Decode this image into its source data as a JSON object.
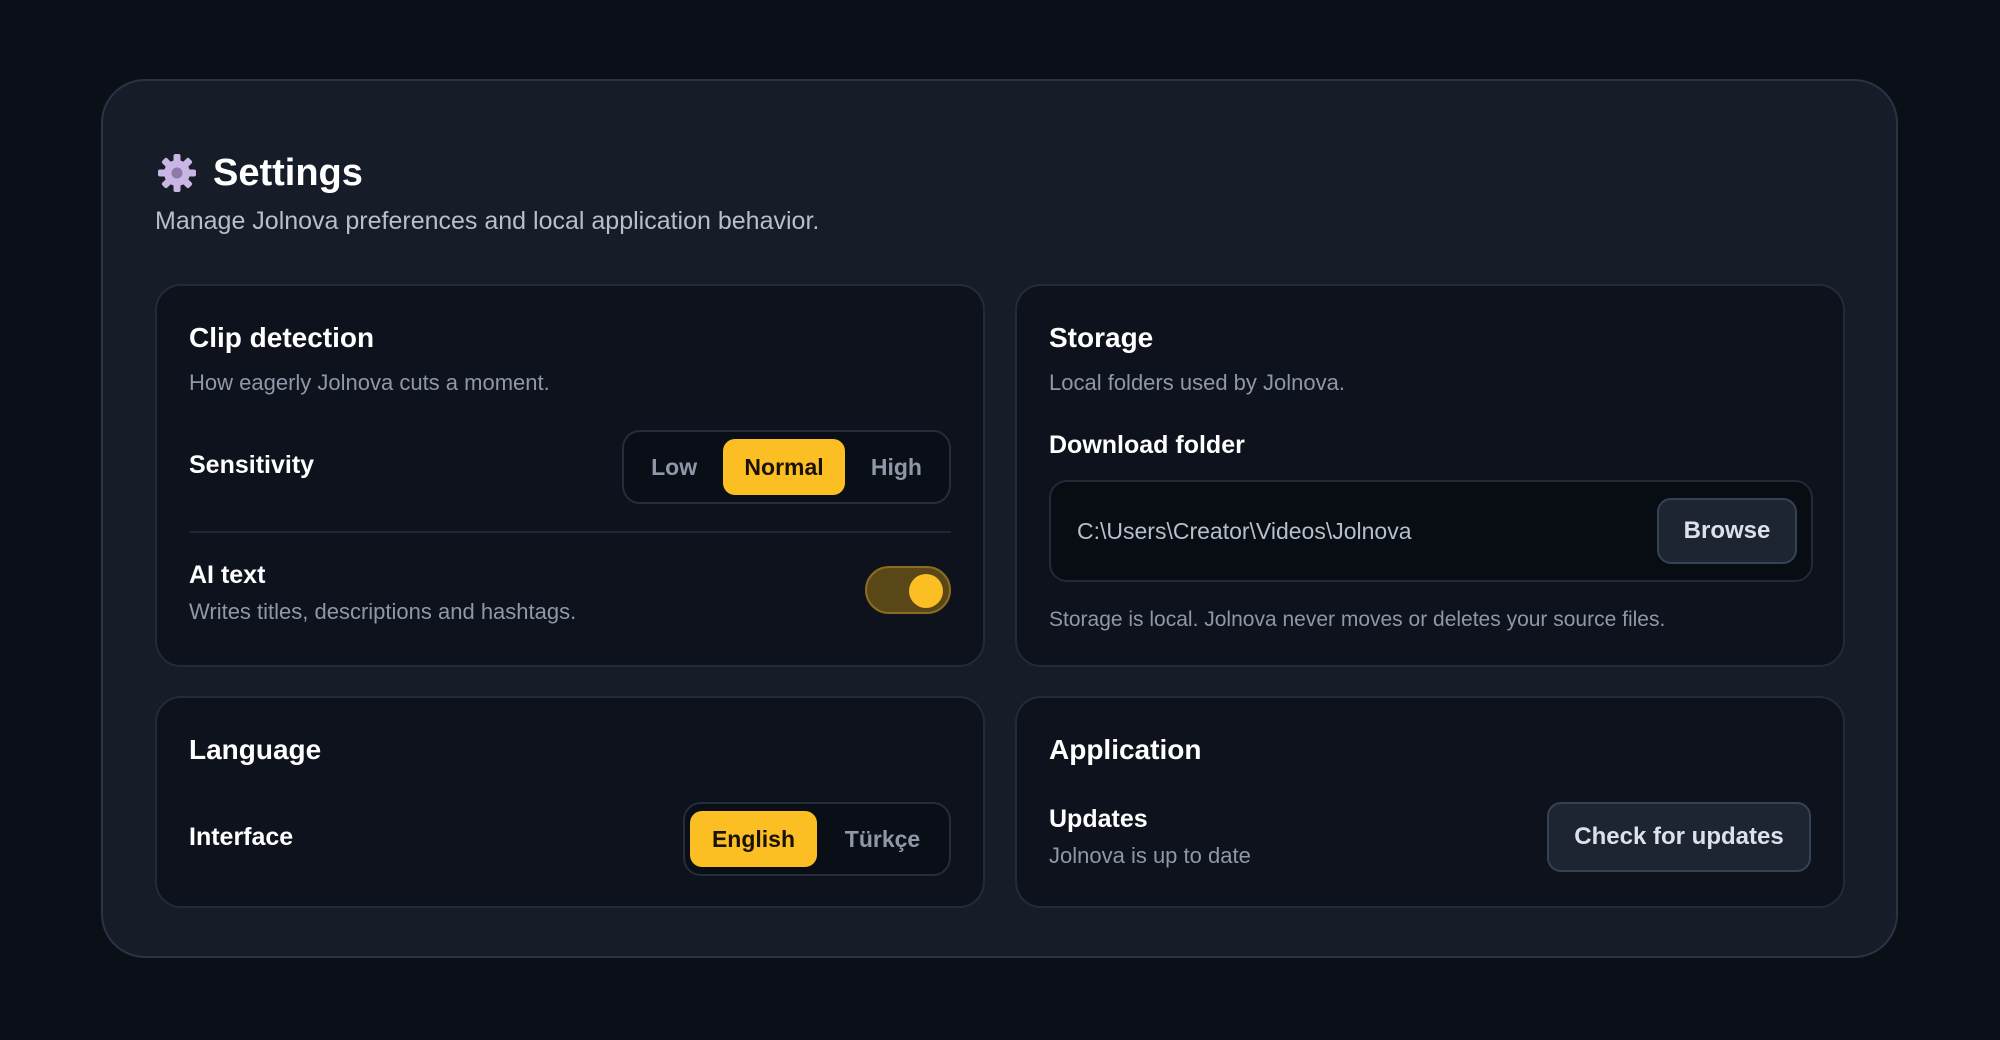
{
  "header": {
    "title": "Settings",
    "subtitle": "Manage Jolnova preferences and local application behavior.",
    "icon": "gear-icon"
  },
  "clip_detection": {
    "title": "Clip detection",
    "description": "How eagerly Jolnova cuts a moment.",
    "sensitivity_label": "Sensitivity",
    "sensitivity_options": [
      "Low",
      "Normal",
      "High"
    ],
    "sensitivity_selected": "Normal",
    "ai_text_label": "AI text",
    "ai_text_description": "Writes titles, descriptions and hashtags.",
    "ai_text_enabled": true
  },
  "storage": {
    "title": "Storage",
    "description": "Local folders used by Jolnova.",
    "download_folder_label": "Download folder",
    "download_folder_path": "C:\\Users\\Creator\\Videos\\Jolnova",
    "browse_label": "Browse",
    "note": "Storage is local. Jolnova never moves or deletes your source files."
  },
  "language": {
    "title": "Language",
    "interface_label": "Interface",
    "options": [
      "English",
      "Türkçe"
    ],
    "selected": "English"
  },
  "application": {
    "title": "Application",
    "updates_label": "Updates",
    "updates_status": "Jolnova is up to date",
    "check_updates_label": "Check for updates"
  },
  "colors": {
    "accent": "#fbbf24",
    "background": "#0b0f17",
    "panel": "#161c28",
    "card": "#0d121c"
  }
}
